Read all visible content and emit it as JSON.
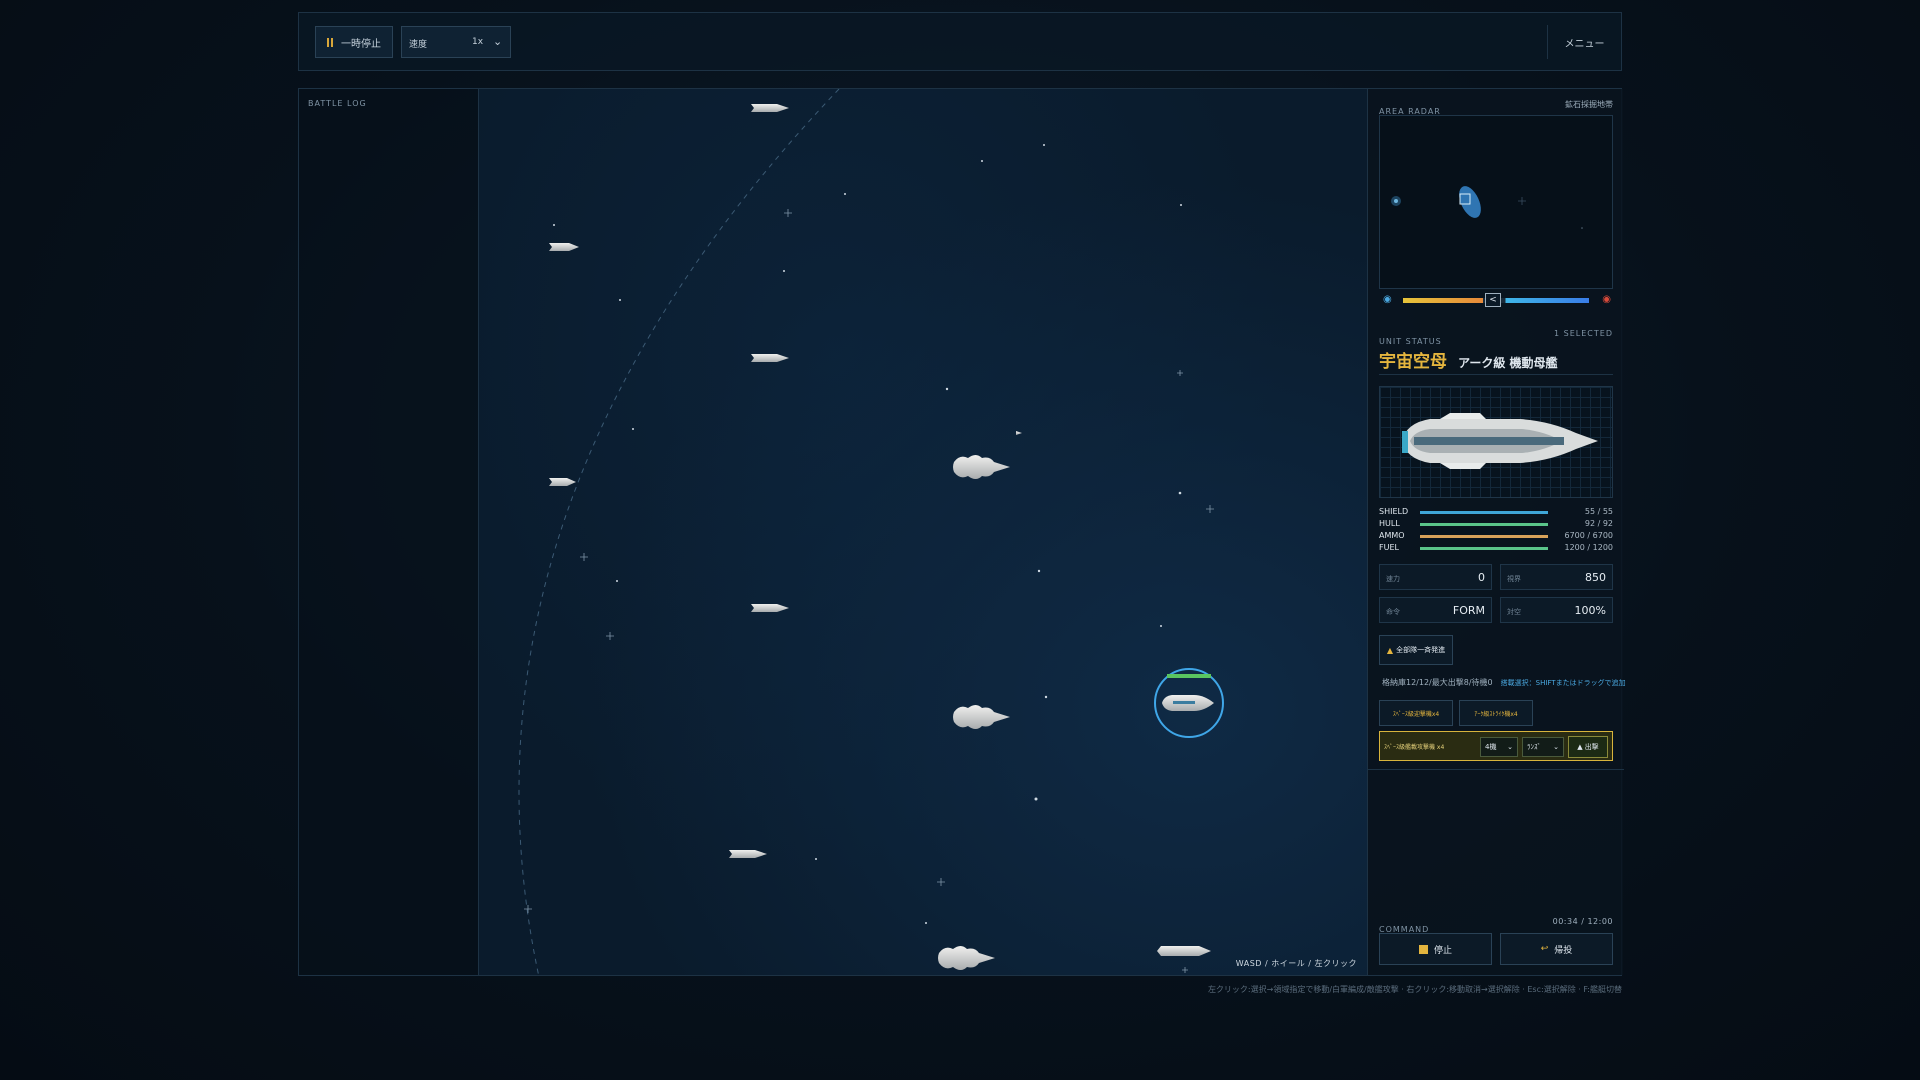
{
  "topbar": {
    "pause_label": "一時停止",
    "speed_label": "速度",
    "speed_value": "1x",
    "menu_label": "メニュー"
  },
  "battle_log": {
    "title": "BATTLE LOG"
  },
  "field": {
    "controls_hint": "WASD / ホイール / 左クリック"
  },
  "radar": {
    "title": "AREA RADAR",
    "area_name": "鉱石採掘地帯",
    "slider_handle": "<"
  },
  "unit_status": {
    "title": "UNIT STATUS",
    "selected": "1 SELECTED",
    "unit_name": "宇宙空母",
    "unit_class": "アーク級 機動母艦",
    "stats": [
      {
        "label": "SHIELD",
        "value": "55 / 55",
        "fill": 1.0,
        "color": "#3fa6d8"
      },
      {
        "label": "HULL",
        "value": "92 / 92",
        "fill": 1.0,
        "color": "#5ac58a"
      },
      {
        "label": "AMMO",
        "value": "6700 / 6700",
        "fill": 1.0,
        "color": "#d8a25a"
      },
      {
        "label": "FUEL",
        "value": "1200 / 1200",
        "fill": 1.0,
        "color": "#5ac58a"
      }
    ],
    "cells": [
      {
        "label": "速力",
        "value": "0"
      },
      {
        "label": "視界",
        "value": "850"
      },
      {
        "label": "命令",
        "value": "FORM"
      },
      {
        "label": "対空",
        "value": "100%"
      }
    ]
  },
  "hangar": {
    "launch_all_label": "全部隊一斉発進",
    "info": "格納庫12/12/最大出撃8/待機0",
    "hint": "搭載選択：SHIFTまたはドラッグで追加",
    "squad_buttons": [
      "ｽﾍﾟｰｽ級迎撃機x4",
      "ｱｰｸ級ｽﾄﾗｲｸ機x4"
    ],
    "deploy_label": "ｽﾍﾟｰｽ級艦載攻撃機 x4",
    "deploy_count": "4機",
    "deploy_mode": "ﾗﾝｽﾞ",
    "deploy_button": "出撃"
  },
  "command": {
    "title": "COMMAND",
    "time": "00:34 / 12:00",
    "stop_label": "停止",
    "retreat_label": "帰投"
  },
  "footer_hint": "左クリック:選択→領域指定で移動/白軍編成/敵艦攻撃 · 右クリック:移動取消→選択解除 · Esc:選択解除 · F:艦艇切替"
}
